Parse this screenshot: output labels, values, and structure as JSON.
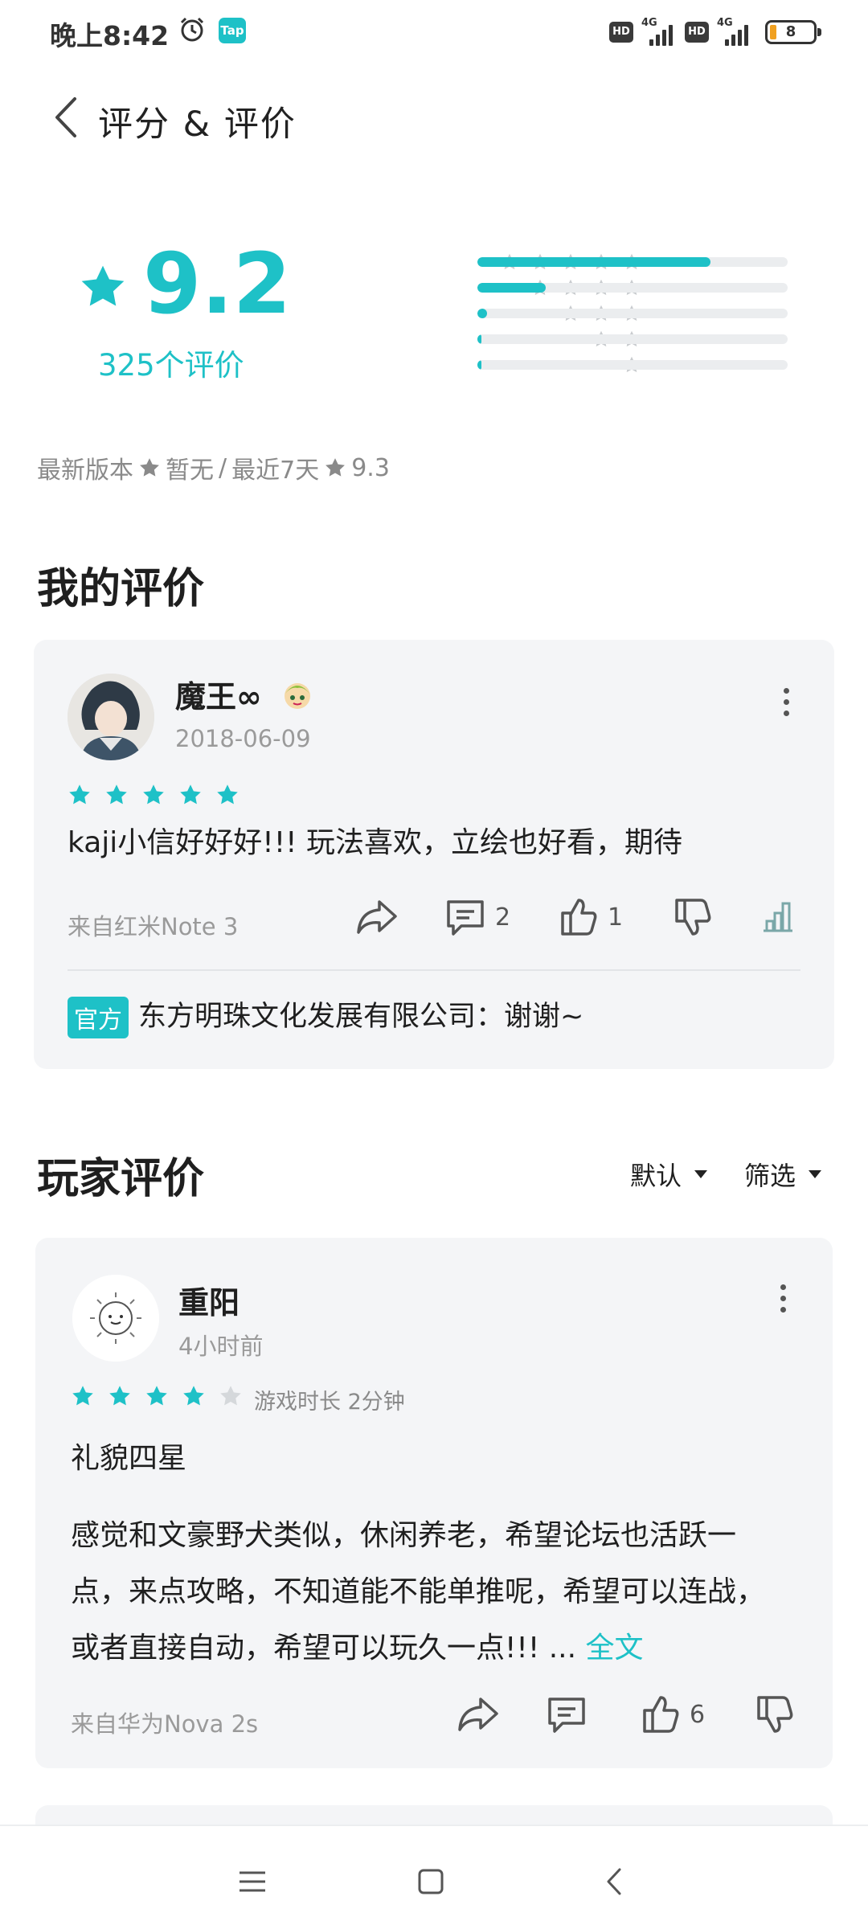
{
  "status_bar": {
    "time": "晚上8:42",
    "tap_badge": "Tap",
    "hd1": "HD",
    "hd2": "HD",
    "net1": "4G",
    "net2": "4G",
    "battery": "8"
  },
  "header": {
    "title": "评分 & 评价",
    "back_icon": "chevron-left-icon"
  },
  "rating": {
    "score": "9.2",
    "count_label": "325个评价",
    "distribution": [
      {
        "stars": 5,
        "fraction": 0.75
      },
      {
        "stars": 4,
        "fraction": 0.22
      },
      {
        "stars": 3,
        "fraction": 0.03
      },
      {
        "stars": 2,
        "fraction": 0.006
      },
      {
        "stars": 1,
        "fraction": 0.006
      }
    ]
  },
  "version_line": {
    "latest_label": "最新版本",
    "latest_value": "暂无",
    "separator": "/",
    "recent_label": "最近7天",
    "recent_value": "9.3"
  },
  "my_review_section": {
    "title": "我的评价"
  },
  "my_review": {
    "username": "魔王∞",
    "date": "2018-06-09",
    "stars": 5,
    "text": "kaji小信好好好!!! 玩法喜欢，立绘也好看，期待",
    "device": "来自红米Note 3",
    "comments": "2",
    "likes": "1",
    "official_tag": "官方",
    "official_reply": "东方明珠文化发展有限公司：谢谢~"
  },
  "player_reviews_section": {
    "title": "玩家评价",
    "sort_label": "默认",
    "filter_label": "筛选"
  },
  "player_review": {
    "username": "重阳",
    "date": "4小时前",
    "stars": 4,
    "playtime": "游戏时长 2分钟",
    "headline": "礼貌四星",
    "body_line1": "感觉和文豪野犬类似，休闲养老，希望论坛也活跃一",
    "body_line2": "点，来点攻略，不知道能不能单推呢，希望可以连战，",
    "body_line3": "或者直接自动，希望可以玩久一点!!!  ...",
    "full_text_link": "全文",
    "device": "来自华为Nova 2s",
    "likes": "6"
  },
  "colors": {
    "accent": "#1ec1c7",
    "card_bg": "#f4f5f7",
    "muted": "#9a9a9a"
  }
}
